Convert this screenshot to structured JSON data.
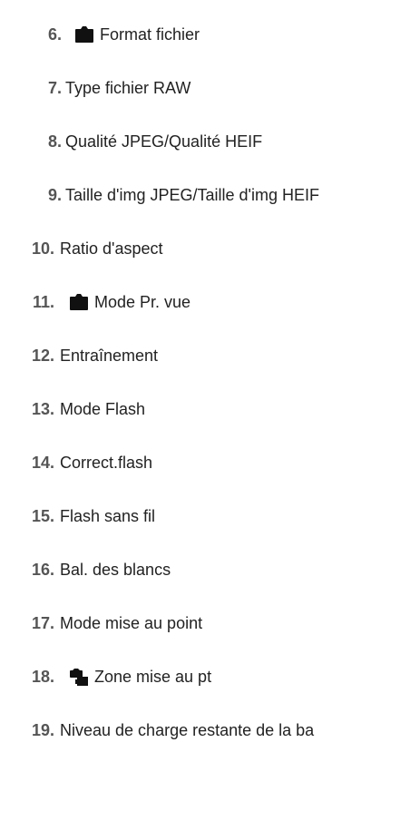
{
  "items": [
    {
      "num": "6.",
      "label": "Format fichier",
      "icon": "camera-still-icon"
    },
    {
      "num": "7.",
      "label": "Type fichier RAW"
    },
    {
      "num": "8.",
      "label": "Qualité JPEG/Qualité HEIF"
    },
    {
      "num": "9.",
      "label": "Taille d'img JPEG/Taille d'img HEIF"
    },
    {
      "num": "10.",
      "label": "Ratio d'aspect"
    },
    {
      "num": "11.",
      "label": "Mode Pr. vue",
      "icon": "camera-still-icon"
    },
    {
      "num": "12.",
      "label": "Entraînement"
    },
    {
      "num": "13.",
      "label": "Mode Flash"
    },
    {
      "num": "14.",
      "label": "Correct.flash"
    },
    {
      "num": "15.",
      "label": "Flash sans fil"
    },
    {
      "num": "16.",
      "label": "Bal. des blancs"
    },
    {
      "num": "17.",
      "label": "Mode mise au point"
    },
    {
      "num": "18.",
      "label": "Zone mise au pt",
      "icon": "camera-still-movie-icon"
    },
    {
      "num": "19.",
      "label": "Niveau de charge restante de la ba"
    }
  ]
}
